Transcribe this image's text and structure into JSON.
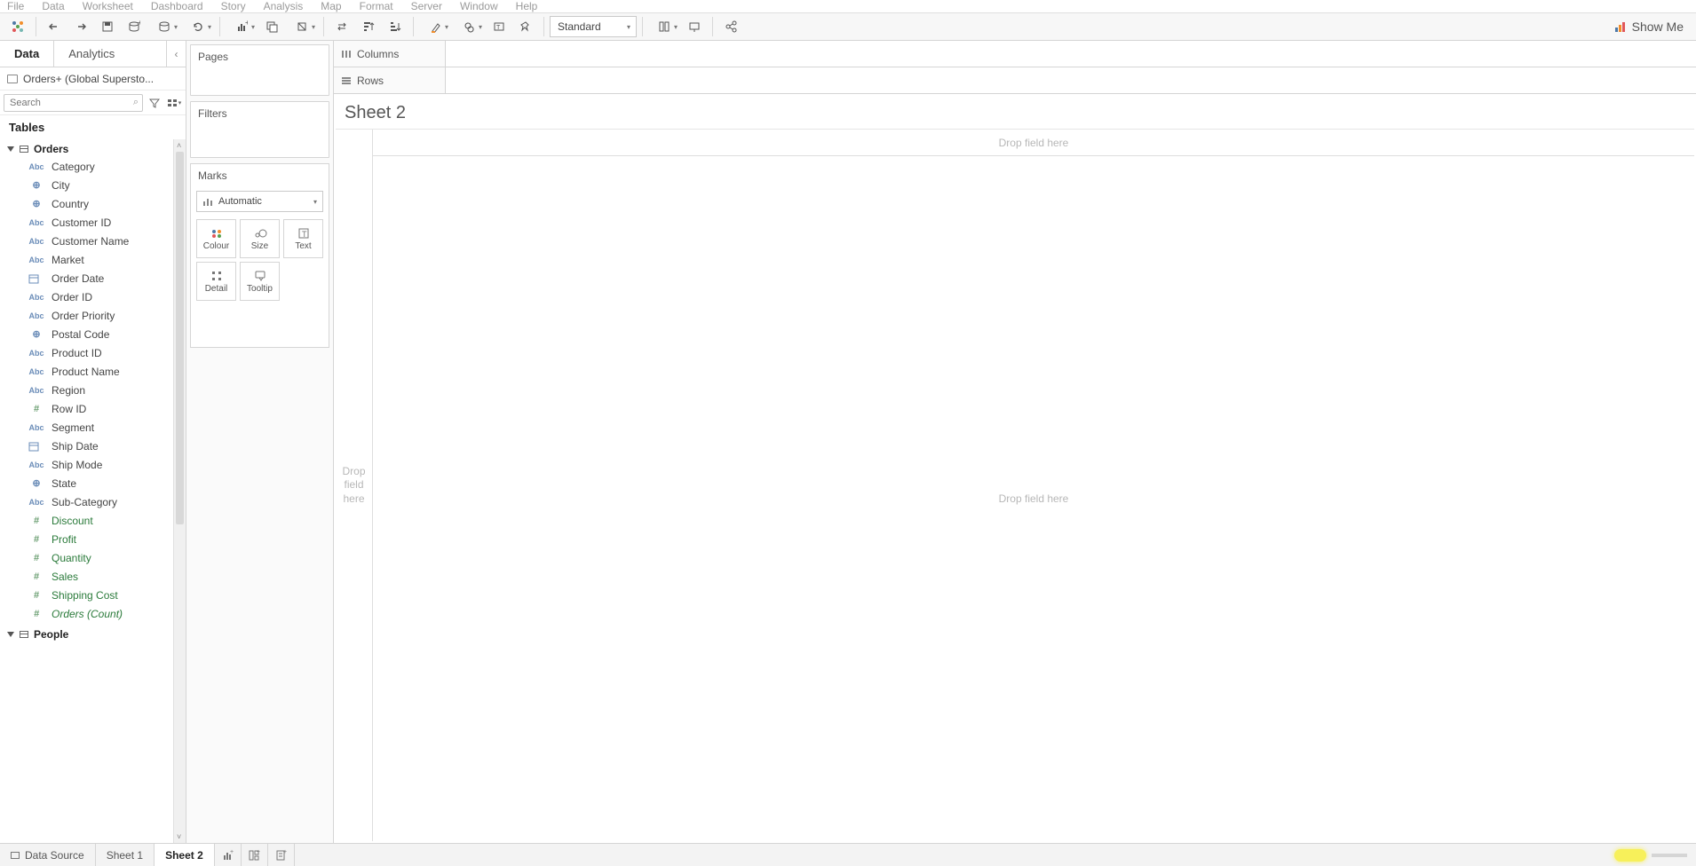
{
  "menubar": [
    "File",
    "Data",
    "Worksheet",
    "Dashboard",
    "Story",
    "Analysis",
    "Map",
    "Format",
    "Server",
    "Window",
    "Help"
  ],
  "toolbar": {
    "fit": "Standard",
    "showme": "Show Me"
  },
  "data_pane": {
    "tabs": {
      "data": "Data",
      "analytics": "Analytics"
    },
    "datasource": "Orders+ (Global Supersto...",
    "search_placeholder": "Search",
    "tables_header": "Tables",
    "tables": [
      {
        "name": "Orders",
        "fields": [
          {
            "icon": "Abc",
            "label": "Category",
            "type": "dim"
          },
          {
            "icon": "geo",
            "label": "City",
            "type": "dim"
          },
          {
            "icon": "geo",
            "label": "Country",
            "type": "dim"
          },
          {
            "icon": "Abc",
            "label": "Customer ID",
            "type": "dim"
          },
          {
            "icon": "Abc",
            "label": "Customer Name",
            "type": "dim"
          },
          {
            "icon": "Abc",
            "label": "Market",
            "type": "dim"
          },
          {
            "icon": "date",
            "label": "Order Date",
            "type": "dim"
          },
          {
            "icon": "Abc",
            "label": "Order ID",
            "type": "dim"
          },
          {
            "icon": "Abc",
            "label": "Order Priority",
            "type": "dim"
          },
          {
            "icon": "geo",
            "label": "Postal Code",
            "type": "dim"
          },
          {
            "icon": "Abc",
            "label": "Product ID",
            "type": "dim"
          },
          {
            "icon": "Abc",
            "label": "Product Name",
            "type": "dim"
          },
          {
            "icon": "Abc",
            "label": "Region",
            "type": "dim"
          },
          {
            "icon": "#",
            "label": "Row ID",
            "type": "dim"
          },
          {
            "icon": "Abc",
            "label": "Segment",
            "type": "dim"
          },
          {
            "icon": "date",
            "label": "Ship Date",
            "type": "dim"
          },
          {
            "icon": "Abc",
            "label": "Ship Mode",
            "type": "dim"
          },
          {
            "icon": "geo",
            "label": "State",
            "type": "dim"
          },
          {
            "icon": "Abc",
            "label": "Sub-Category",
            "type": "dim"
          },
          {
            "icon": "#",
            "label": "Discount",
            "type": "meas"
          },
          {
            "icon": "#",
            "label": "Profit",
            "type": "meas"
          },
          {
            "icon": "#",
            "label": "Quantity",
            "type": "meas"
          },
          {
            "icon": "#",
            "label": "Sales",
            "type": "meas"
          },
          {
            "icon": "#",
            "label": "Shipping Cost",
            "type": "meas"
          },
          {
            "icon": "#",
            "label": "Orders (Count)",
            "type": "meas",
            "italic": true
          }
        ]
      },
      {
        "name": "People",
        "fields": []
      }
    ]
  },
  "shelves": {
    "pages": "Pages",
    "filters": "Filters",
    "marks": "Marks",
    "mark_type": "Automatic",
    "cards": {
      "colour": "Colour",
      "size": "Size",
      "text": "Text",
      "detail": "Detail",
      "tooltip": "Tooltip"
    }
  },
  "view": {
    "columns": "Columns",
    "rows": "Rows",
    "title": "Sheet 2",
    "drop_top": "Drop field here",
    "drop_left": "Drop\nfield\nhere",
    "drop_center": "Drop field here"
  },
  "tabs": {
    "datasource": "Data Source",
    "sheets": [
      "Sheet 1",
      "Sheet 2"
    ],
    "active": 1
  }
}
